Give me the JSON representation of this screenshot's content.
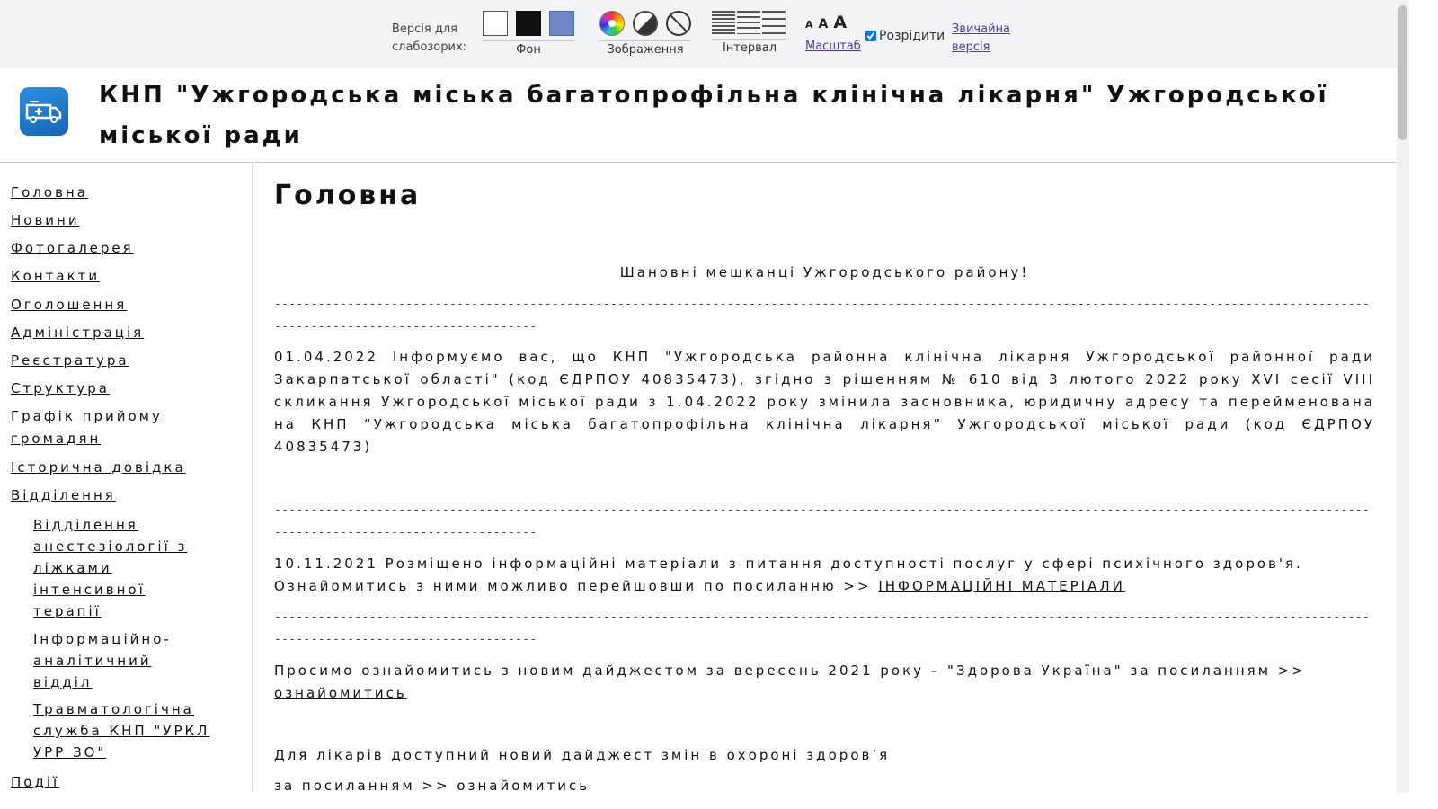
{
  "toolbar": {
    "version_label": "Версія для слабозорих:",
    "background_caption": "Фон",
    "images_caption": "Зображення",
    "interval_caption": "Інтервал",
    "scale_letters": [
      "A",
      "A",
      "A"
    ],
    "scale_link": "Масштаб",
    "spread_label": "Розрідити",
    "spread_checked": true,
    "normal_version": "Звичайна версія"
  },
  "header": {
    "title": "КНП \"Ужгородська міська багатопрофільна клінічна лікарня\" Ужгородської міської ради"
  },
  "sidebar": {
    "items": [
      "Головна",
      "Новини",
      "Фотогалерея",
      "Контакти",
      "Оголошення",
      "Адміністрація",
      "Реєстратура",
      "Структура",
      "Графік прийому громадян",
      "Історична довідка",
      "Відділення"
    ],
    "subitems": [
      "Відділення анестезіології з ліжками інтенсивної терапії",
      "Інформаційно-аналітичний відділ",
      "Травматологічна служба КНП \"УРКЛ УРР ЗО\""
    ],
    "last_item": "Події"
  },
  "main": {
    "page_title": "Головна",
    "greeting": "Шановні мешканці Ужгородського району!",
    "separator": "------------------------------------------------------------------------------------------------------------------------------------------------------------------------------------------",
    "news1": "01.04.2022 Інформуємо вас, що КНП \"Ужгородська районна клінічна лікарня Ужгородської районної ради Закарпатської області\"  (код ЄДРПОУ 40835473), згідно з рішенням № 610 від 3 лютого 2022 року XVI сесії VIII скликання Ужгородської міської ради з 1.04.2022 року змінила засновника, юридичну адресу та перейменована на КНП “Ужгородська міська багатопрофільна клінічна лікарня” Ужгородської міської ради (код ЄДРПОУ 40835473)",
    "news2_text": "10.11.2021 Розміщено інформаційні матеріали з питання доступності послуг у сфері психічного здоров'я. Ознайомитись з ними можливо перейшовши по посиланню >> ",
    "news2_link": "ІНФОРМАЦІЙНІ МАТЕРІАЛИ",
    "news3_text": "Просимо ознайомитись з новим дайджестом за вересень 2021 року – \"Здорова Україна\" за посиланням >> ",
    "news3_link": "ознайомитись",
    "news4_text": "Для лікарів доступний новий дайджест змін в охороні здоров’я",
    "news5_text": "за посиланням >>  ознайомитись"
  }
}
